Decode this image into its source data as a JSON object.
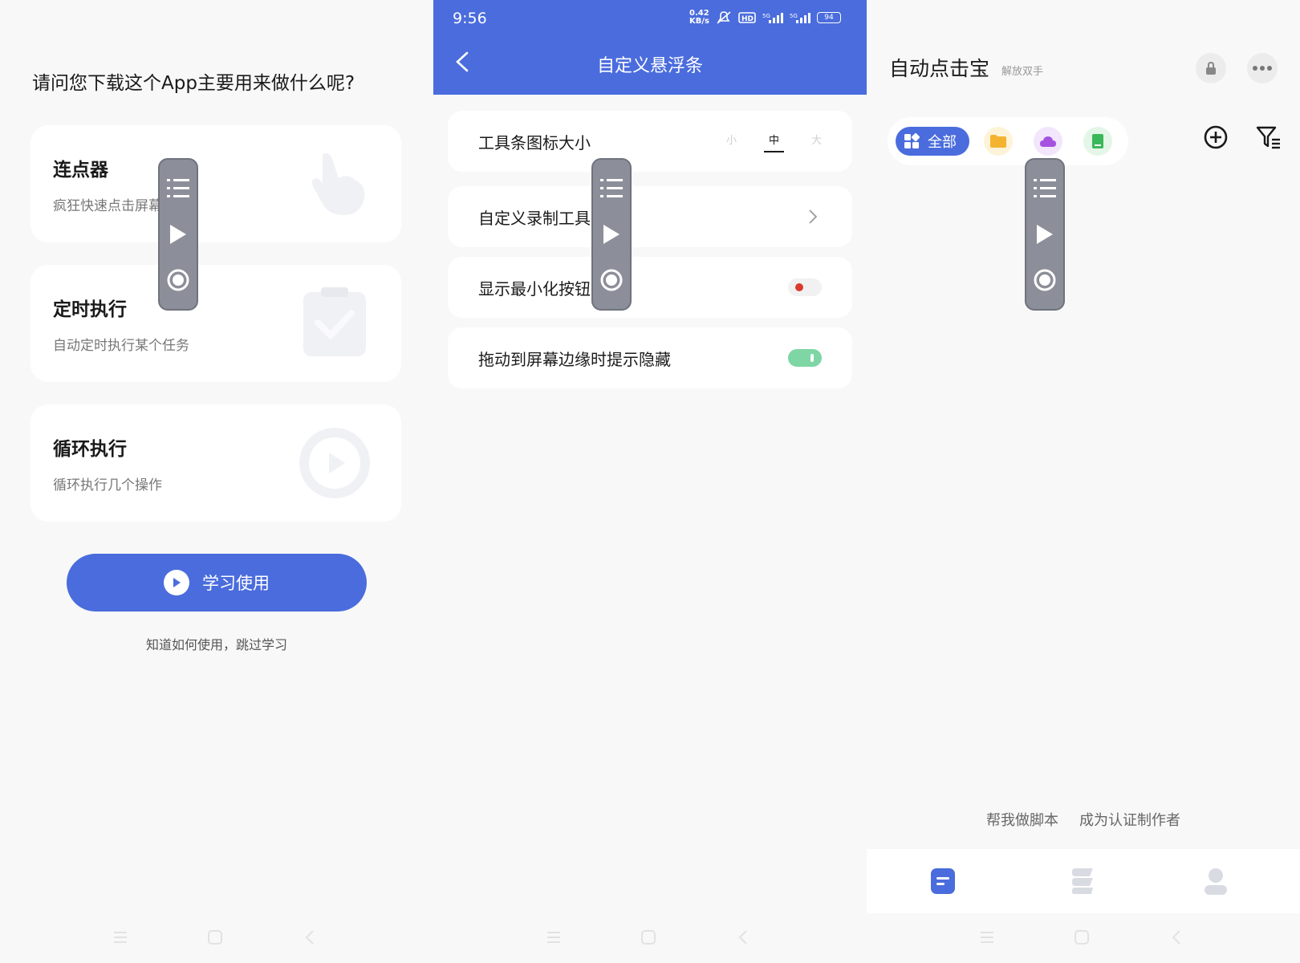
{
  "panel_survey": {
    "question": "请问您下载这个App主要用来做什么呢?",
    "cards": [
      {
        "title": "连点器",
        "subtitle": "疯狂快速点击屏幕",
        "icon": "pointer-hand-icon"
      },
      {
        "title": "定时执行",
        "subtitle": "自动定时执行某个任务",
        "icon": "clipboard-check-icon"
      },
      {
        "title": "循环执行",
        "subtitle": "循环执行几个操作",
        "icon": "play-circle-icon"
      }
    ],
    "learn_button": "学习使用",
    "skip_link": "知道如何使用，跳过学习"
  },
  "panel_settings": {
    "status_time": "9:56",
    "status_speed": "0.42\nKB/s",
    "status_battery": "94",
    "header_title": "自定义悬浮条",
    "rows": {
      "icon_size": {
        "label": "工具条图标大小",
        "options": [
          "小",
          "中",
          "大"
        ],
        "selected": "中"
      },
      "custom_record": {
        "label": "自定义录制工具条"
      },
      "show_minimize": {
        "label": "显示最小化按钮",
        "toggled": false
      },
      "edge_hide_hint": {
        "label": "拖动到屏幕边缘时提示隐藏",
        "toggled": true
      }
    }
  },
  "panel_home": {
    "app_name": "自动点击宝",
    "app_tagline": "解放双手",
    "filter_all": "全部",
    "bottom_links": [
      "帮我做脚本",
      "成为认证制作者"
    ]
  },
  "colors": {
    "primary": "#4a6cdd",
    "toggle_on": "#7dd6a4",
    "toggle_off_dot": "#d93a2e",
    "float_bar": "#8c8f99"
  }
}
